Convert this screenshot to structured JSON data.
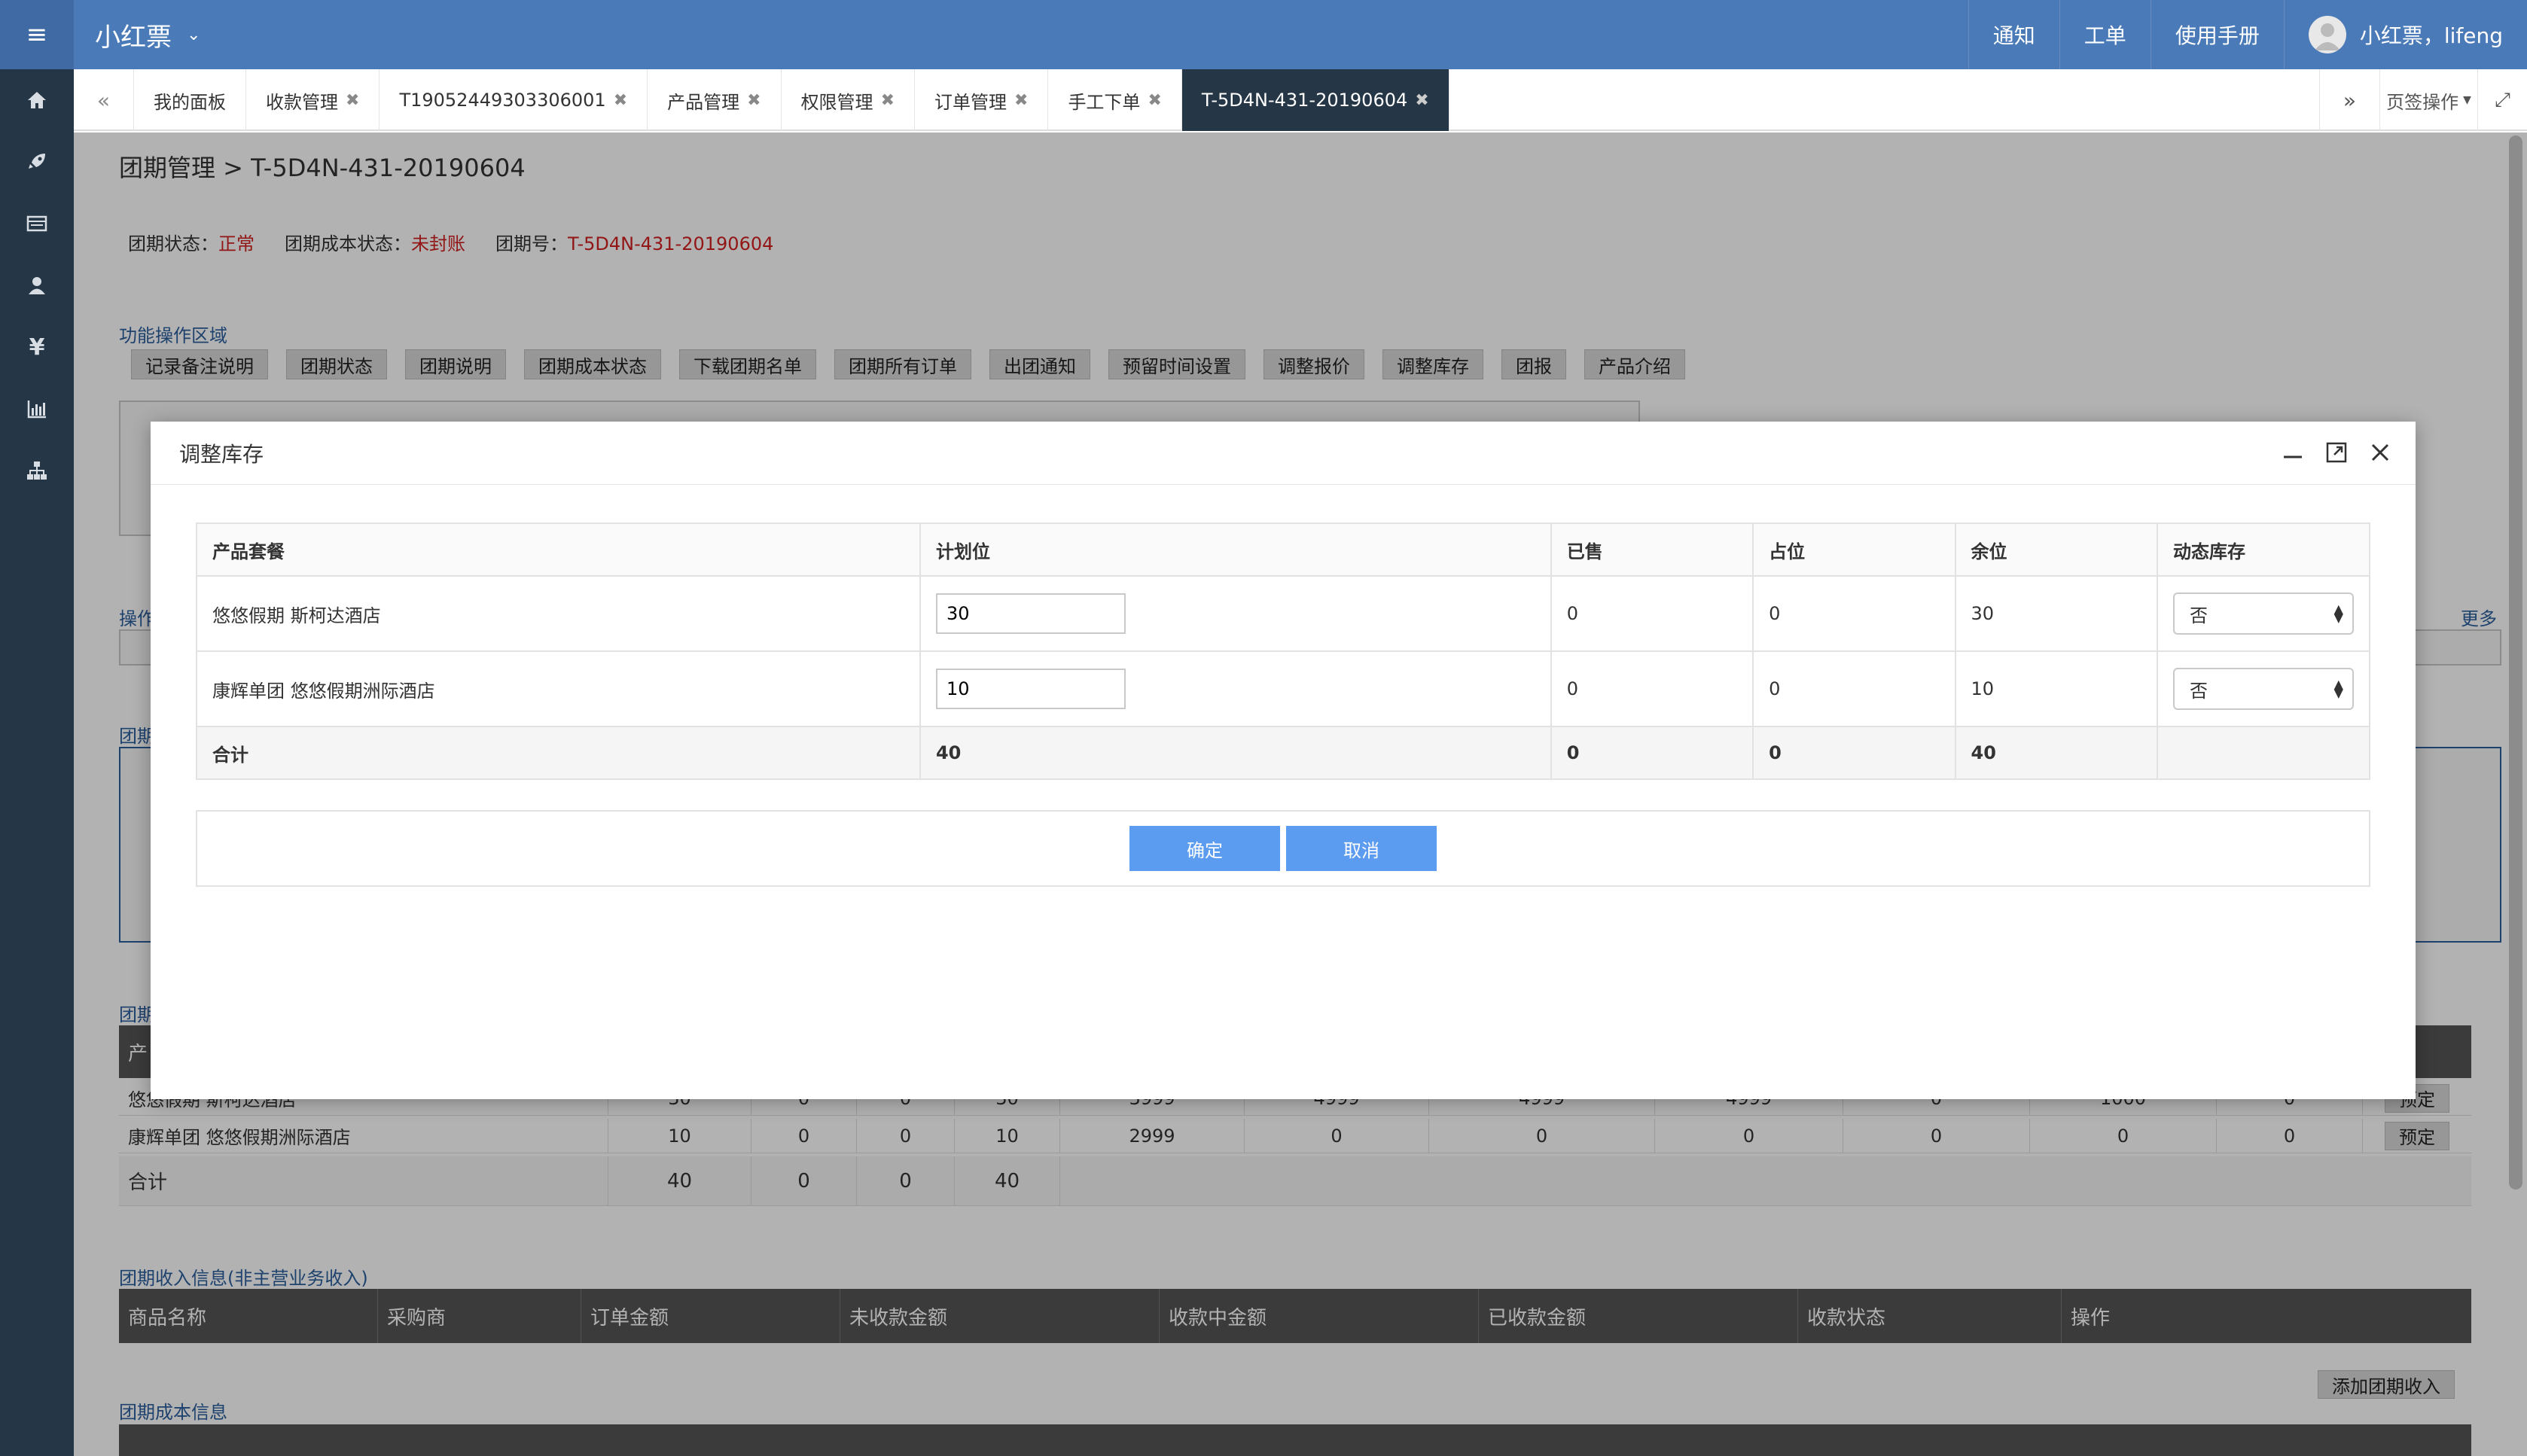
{
  "app": {
    "brand": "小红票"
  },
  "topnav": {
    "items": [
      "通知",
      "工单",
      "使用手册"
    ],
    "user": "小红票，lifeng"
  },
  "sidebar_icons": [
    "home-icon",
    "rocket-icon",
    "list-icon",
    "user-icon",
    "yen-icon",
    "bar-chart-icon",
    "sitemap-icon"
  ],
  "tabs": [
    {
      "label": "我的面板",
      "closable": false
    },
    {
      "label": "收款管理",
      "closable": true
    },
    {
      "label": "T19052449303306001",
      "closable": true
    },
    {
      "label": "产品管理",
      "closable": true
    },
    {
      "label": "权限管理",
      "closable": true
    },
    {
      "label": "订单管理",
      "closable": true
    },
    {
      "label": "手工下单",
      "closable": true
    },
    {
      "label": "T-5D4N-431-20190604",
      "closable": true,
      "active": true
    }
  ],
  "tab_ops": "页签操作",
  "page": {
    "breadcrumb_parent": "团期管理 >",
    "breadcrumb_current": "T-5D4N-431-20190604",
    "status_label": "团期状态：",
    "status_value": "正常",
    "cost_status_label": "团期成本状态：",
    "cost_status_value": "未封账",
    "tour_no_label": "团期号：",
    "tour_no_value": "T-5D4N-431-20190604",
    "func_area_title": "功能操作区域",
    "func_buttons": [
      "记录备注说明",
      "团期状态",
      "团期说明",
      "团期成本状态",
      "下载团期名单",
      "团期所有订单",
      "出团通知",
      "预留时间设置",
      "调整报价",
      "调整库存",
      "团报",
      "产品介绍"
    ],
    "ops_label": "操作",
    "more_label": "更多",
    "tuan_label1": "团期",
    "tuan_label2": "团期",
    "prod_head_stub": "产",
    "bg_rows": [
      {
        "name": "悠悠假期 斯柯达酒店",
        "cols": [
          "30",
          "0",
          "0",
          "30",
          "3999",
          "4999",
          "4999",
          "4999",
          "0",
          "1000",
          "0"
        ],
        "btn": "预定"
      },
      {
        "name": "康辉单团 悠悠假期洲际酒店",
        "cols": [
          "10",
          "0",
          "0",
          "10",
          "2999",
          "0",
          "0",
          "0",
          "0",
          "0",
          "0"
        ],
        "btn": "预定"
      }
    ],
    "bg_total": {
      "name": "合计",
      "cols": [
        "40",
        "0",
        "0",
        "40"
      ]
    },
    "income_title": "团期收入信息(非主营业务收入)",
    "income_headers": [
      "商品名称",
      "采购商",
      "订单金额",
      "未收款金额",
      "收款中金额",
      "已收款金额",
      "收款状态",
      "操作"
    ],
    "add_income": "添加团期收入",
    "cost_title": "团期成本信息"
  },
  "modal": {
    "title": "调整库存",
    "headers": [
      "产品套餐",
      "计划位",
      "已售",
      "占位",
      "余位",
      "动态库存"
    ],
    "rows": [
      {
        "name": "悠悠假期 斯柯达酒店",
        "plan": "30",
        "sold": "0",
        "held": "0",
        "remain": "30",
        "dynamic": "否"
      },
      {
        "name": "康辉单团 悠悠假期洲际酒店",
        "plan": "10",
        "sold": "0",
        "held": "0",
        "remain": "10",
        "dynamic": "否"
      }
    ],
    "total": {
      "name": "合计",
      "plan": "40",
      "sold": "0",
      "held": "0",
      "remain": "40"
    },
    "confirm": "确定",
    "cancel": "取消"
  }
}
